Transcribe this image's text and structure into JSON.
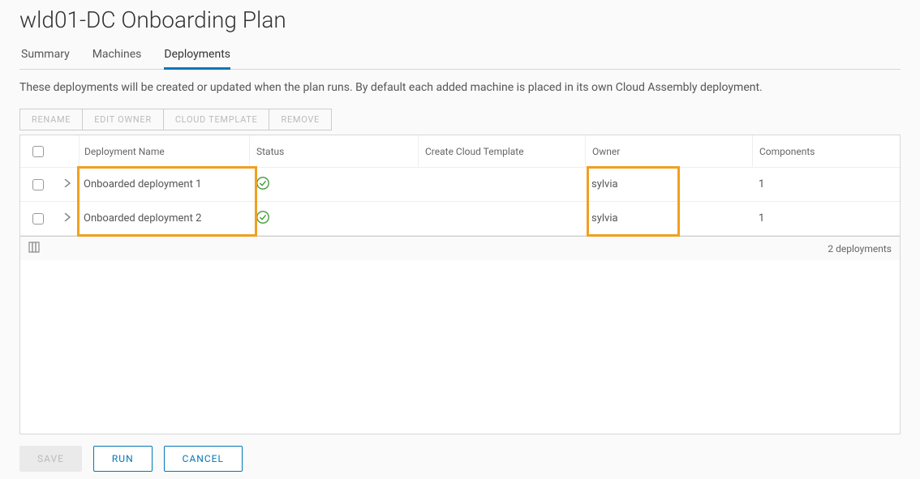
{
  "page_title": "wld01-DC Onboarding Plan",
  "tabs": {
    "summary": "Summary",
    "machines": "Machines",
    "deployments": "Deployments"
  },
  "active_tab": "deployments",
  "description": "These deployments will be created or updated when the plan runs. By default each added machine is placed in its own Cloud Assembly deployment.",
  "toolbar": {
    "rename": "RENAME",
    "edit_owner": "EDIT OWNER",
    "cloud_template": "CLOUD TEMPLATE",
    "remove": "REMOVE"
  },
  "columns": {
    "name": "Deployment Name",
    "status": "Status",
    "cloud": "Create Cloud Template",
    "owner": "Owner",
    "components": "Components"
  },
  "rows": [
    {
      "name": "Onboarded deployment 1",
      "status": "ok",
      "cloud": "",
      "owner": "sylvia",
      "components": "1"
    },
    {
      "name": "Onboarded deployment 2",
      "status": "ok",
      "cloud": "",
      "owner": "sylvia",
      "components": "1"
    }
  ],
  "footer_count": "2 deployments",
  "actions": {
    "save": "SAVE",
    "run": "RUN",
    "cancel": "CANCEL"
  }
}
